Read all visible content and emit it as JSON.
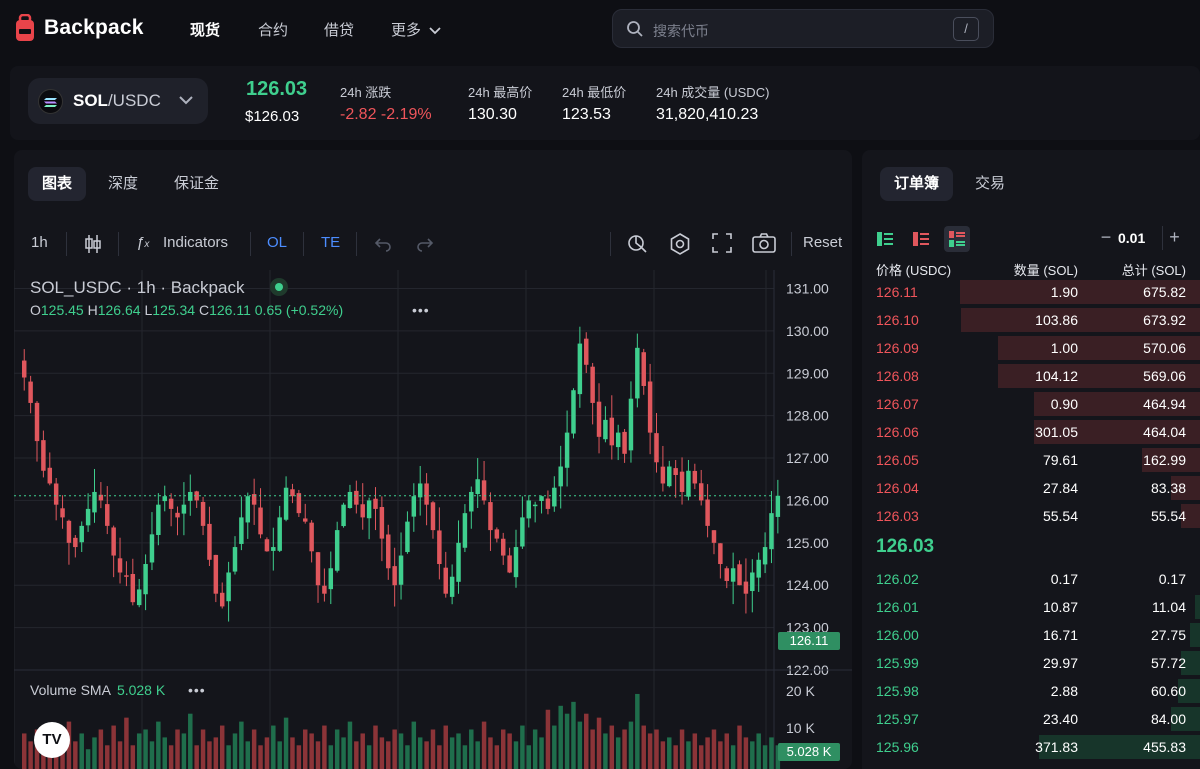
{
  "brand": {
    "name": "Backpack"
  },
  "nav": {
    "items": [
      {
        "label": "现货",
        "active": true
      },
      {
        "label": "合约",
        "active": false
      },
      {
        "label": "借贷",
        "active": false
      },
      {
        "label": "更多",
        "active": false
      }
    ],
    "search_placeholder": "搜索代币",
    "search_shortcut": "/"
  },
  "ticker": {
    "pair_base": "SOL",
    "pair_quote": "/USDC",
    "last_price": "126.03",
    "last_price_usd": "$126.03",
    "stats": [
      {
        "label": "24h 涨跌",
        "value": "-2.82 -2.19%",
        "color": "red"
      },
      {
        "label": "24h 最高价",
        "value": "130.30",
        "color": "white"
      },
      {
        "label": "24h 最低价",
        "value": "123.53",
        "color": "white"
      },
      {
        "label": "24h 成交量 (USDC)",
        "value": "31,820,410.23",
        "color": "white"
      }
    ]
  },
  "chart_panel": {
    "tabs": [
      "图表",
      "深度",
      "保证金"
    ],
    "toolbar": {
      "interval": "1h",
      "indicators": "Indicators",
      "ol": "OL",
      "te": "TE",
      "reset": "Reset"
    },
    "legend": {
      "title": "SOL_USDC · 1h · Backpack",
      "o_label": "O",
      "o": "125.45",
      "h_label": "H",
      "h": "126.64",
      "l_label": "L",
      "l": "125.34",
      "c_label": "C",
      "c": "126.11",
      "change": "0.65 (+0.52%)"
    },
    "volume": {
      "label": "Volume SMA",
      "value": "5.028 K"
    },
    "watermark": "TV"
  },
  "chart_data": {
    "type": "candlestick",
    "symbol": "SOL_USDC",
    "interval": "1h",
    "y_axis_ticks": [
      "131.00",
      "130.00",
      "129.00",
      "128.00",
      "127.00",
      "126.00",
      "125.00",
      "124.00",
      "123.00",
      "122.00"
    ],
    "ylim": [
      122,
      131.2
    ],
    "current_price": "126.11",
    "current_price_tag": "126.11",
    "volume_ticks": [
      "20 K",
      "10 K"
    ],
    "volume_sma_tag": "5.028 K",
    "colors": {
      "up": "#3fcf8e",
      "down": "#e0575d",
      "grid": "#24262e"
    },
    "close_path": [
      128.9,
      128.3,
      127.4,
      126.7,
      126.4,
      125.9,
      125.6,
      125.0,
      124.9,
      125.4,
      125.8,
      126.2,
      126.0,
      125.4,
      124.7,
      124.3,
      124.2,
      123.6,
      123.9,
      124.5,
      125.2,
      125.9,
      126.1,
      125.8,
      125.6,
      125.9,
      126.2,
      126.0,
      125.4,
      124.6,
      123.8,
      123.5,
      124.3,
      124.9,
      125.6,
      126.1,
      125.9,
      125.2,
      124.8,
      124.9,
      125.6,
      126.3,
      126.1,
      125.7,
      125.5,
      124.8,
      124.0,
      123.8,
      124.4,
      125.3,
      125.9,
      126.2,
      125.9,
      125.6,
      126.0,
      125.8,
      125.1,
      124.4,
      124.0,
      124.7,
      125.5,
      126.1,
      126.4,
      125.9,
      125.3,
      124.5,
      123.8,
      124.2,
      125.0,
      125.7,
      126.2,
      126.5,
      126.0,
      125.3,
      125.1,
      124.7,
      124.3,
      124.9,
      125.6,
      126.0,
      125.9,
      126.1,
      125.8,
      126.3,
      126.8,
      127.6,
      128.6,
      129.7,
      129.2,
      128.3,
      127.5,
      127.9,
      127.3,
      127.6,
      127.1,
      128.4,
      129.6,
      128.7,
      127.6,
      126.9,
      126.4,
      126.8,
      126.6,
      126.2,
      126.7,
      126.4,
      126.0,
      125.4,
      125.0,
      124.5,
      124.1,
      124.4,
      124.0,
      123.8,
      124.3,
      124.6,
      124.9,
      125.7,
      126.11
    ],
    "volume_path": [
      0.45,
      0.35,
      0.5,
      0.3,
      0.55,
      0.4,
      0.3,
      0.6,
      0.35,
      0.45,
      0.25,
      0.4,
      0.5,
      0.3,
      0.55,
      0.35,
      0.65,
      0.3,
      0.45,
      0.5,
      0.35,
      0.6,
      0.4,
      0.3,
      0.5,
      0.45,
      0.7,
      0.3,
      0.5,
      0.35,
      0.4,
      0.55,
      0.3,
      0.45,
      0.6,
      0.35,
      0.5,
      0.3,
      0.4,
      0.55,
      0.35,
      0.65,
      0.4,
      0.3,
      0.5,
      0.45,
      0.35,
      0.55,
      0.3,
      0.5,
      0.4,
      0.6,
      0.35,
      0.45,
      0.3,
      0.55,
      0.4,
      0.35,
      0.5,
      0.45,
      0.3,
      0.6,
      0.4,
      0.35,
      0.5,
      0.3,
      0.55,
      0.4,
      0.45,
      0.3,
      0.5,
      0.35,
      0.6,
      0.4,
      0.3,
      0.5,
      0.45,
      0.35,
      0.55,
      0.3,
      0.5,
      0.4,
      0.75,
      0.55,
      0.8,
      0.7,
      0.85,
      0.6,
      0.7,
      0.5,
      0.65,
      0.45,
      0.55,
      0.4,
      0.5,
      0.6,
      0.95,
      0.55,
      0.45,
      0.5,
      0.35,
      0.4,
      0.3,
      0.5,
      0.35,
      0.45,
      0.3,
      0.4,
      0.5,
      0.35,
      0.45,
      0.3,
      0.55,
      0.4,
      0.35,
      0.45,
      0.3,
      0.4,
      0.3
    ]
  },
  "order_book": {
    "tabs": [
      "订单簿",
      "交易"
    ],
    "tick_size": "0.01",
    "headers": {
      "price": "价格 (USDC)",
      "qty": "数量 (SOL)",
      "total": "总计 (SOL)"
    },
    "asks": [
      {
        "price": "126.11",
        "qty": "1.90",
        "total": "675.82",
        "depth": 1.0
      },
      {
        "price": "126.10",
        "qty": "103.86",
        "total": "673.92",
        "depth": 0.997
      },
      {
        "price": "126.09",
        "qty": "1.00",
        "total": "570.06",
        "depth": 0.84
      },
      {
        "price": "126.08",
        "qty": "104.12",
        "total": "569.06",
        "depth": 0.84
      },
      {
        "price": "126.07",
        "qty": "0.90",
        "total": "464.94",
        "depth": 0.69
      },
      {
        "price": "126.06",
        "qty": "301.05",
        "total": "464.04",
        "depth": 0.69
      },
      {
        "price": "126.05",
        "qty": "79.61",
        "total": "162.99",
        "depth": 0.24
      },
      {
        "price": "126.04",
        "qty": "27.84",
        "total": "83.38",
        "depth": 0.12
      },
      {
        "price": "126.03",
        "qty": "55.54",
        "total": "55.54",
        "depth": 0.08
      }
    ],
    "mid_price": "126.03",
    "bids": [
      {
        "price": "126.02",
        "qty": "0.17",
        "total": "0.17",
        "depth": 0.0
      },
      {
        "price": "126.01",
        "qty": "10.87",
        "total": "11.04",
        "depth": 0.02
      },
      {
        "price": "126.00",
        "qty": "16.71",
        "total": "27.75",
        "depth": 0.04
      },
      {
        "price": "125.99",
        "qty": "29.97",
        "total": "57.72",
        "depth": 0.08
      },
      {
        "price": "125.98",
        "qty": "2.88",
        "total": "60.60",
        "depth": 0.09
      },
      {
        "price": "125.97",
        "qty": "23.40",
        "total": "84.00",
        "depth": 0.12
      },
      {
        "price": "125.96",
        "qty": "371.83",
        "total": "455.83",
        "depth": 0.67
      }
    ]
  }
}
